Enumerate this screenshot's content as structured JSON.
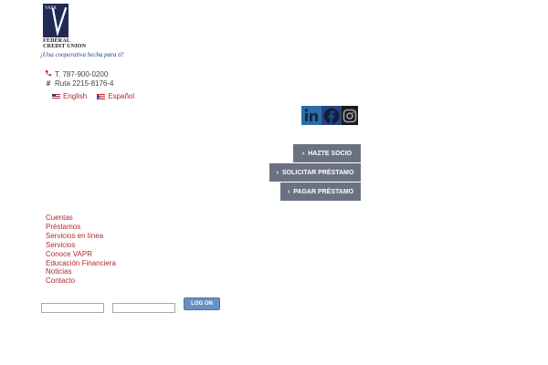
{
  "logo": {
    "mark_text": "VAPR",
    "line1": "FEDERAL",
    "line2": "CREDIT UNION",
    "tagline": "¡Una cooperativa hecha para ti!"
  },
  "contact": {
    "phone": "T. 787-900-0200",
    "phone_icon": "phone-icon",
    "route": "Ruta 2215-8176-4",
    "route_icon": "hash-icon"
  },
  "languages": [
    {
      "label": "English",
      "flag": "us-flag-icon"
    },
    {
      "label": "Español",
      "flag": "pr-flag-icon"
    }
  ],
  "social": [
    {
      "name": "linkedin-icon",
      "glyph": "in",
      "color": "#2b6fa8"
    },
    {
      "name": "facebook-icon",
      "glyph": "f",
      "color": "#24457e"
    },
    {
      "name": "instagram-icon",
      "glyph": "",
      "color": "#1a1a1a"
    }
  ],
  "actions": {
    "socio": "HAZTE SOCIO",
    "prestamo": "SOLICITAR PRÉSTAMO",
    "pagar": "PAGAR PRÉSTAMO",
    "chevron": "›"
  },
  "nav": [
    "Cuentas",
    "Préstamos",
    "Servicios en línea",
    "Servicios",
    "Conoce VAPR",
    "Educación Financiera",
    "Noticias",
    "Contacto"
  ],
  "login": {
    "user_value": "",
    "pass_value": "",
    "button": "LOG ON"
  },
  "colors": {
    "accent_red": "#b02a2a",
    "button_gray": "#6a7282",
    "logon_blue": "#6b8fc1",
    "brand_navy": "#1f2a55"
  }
}
